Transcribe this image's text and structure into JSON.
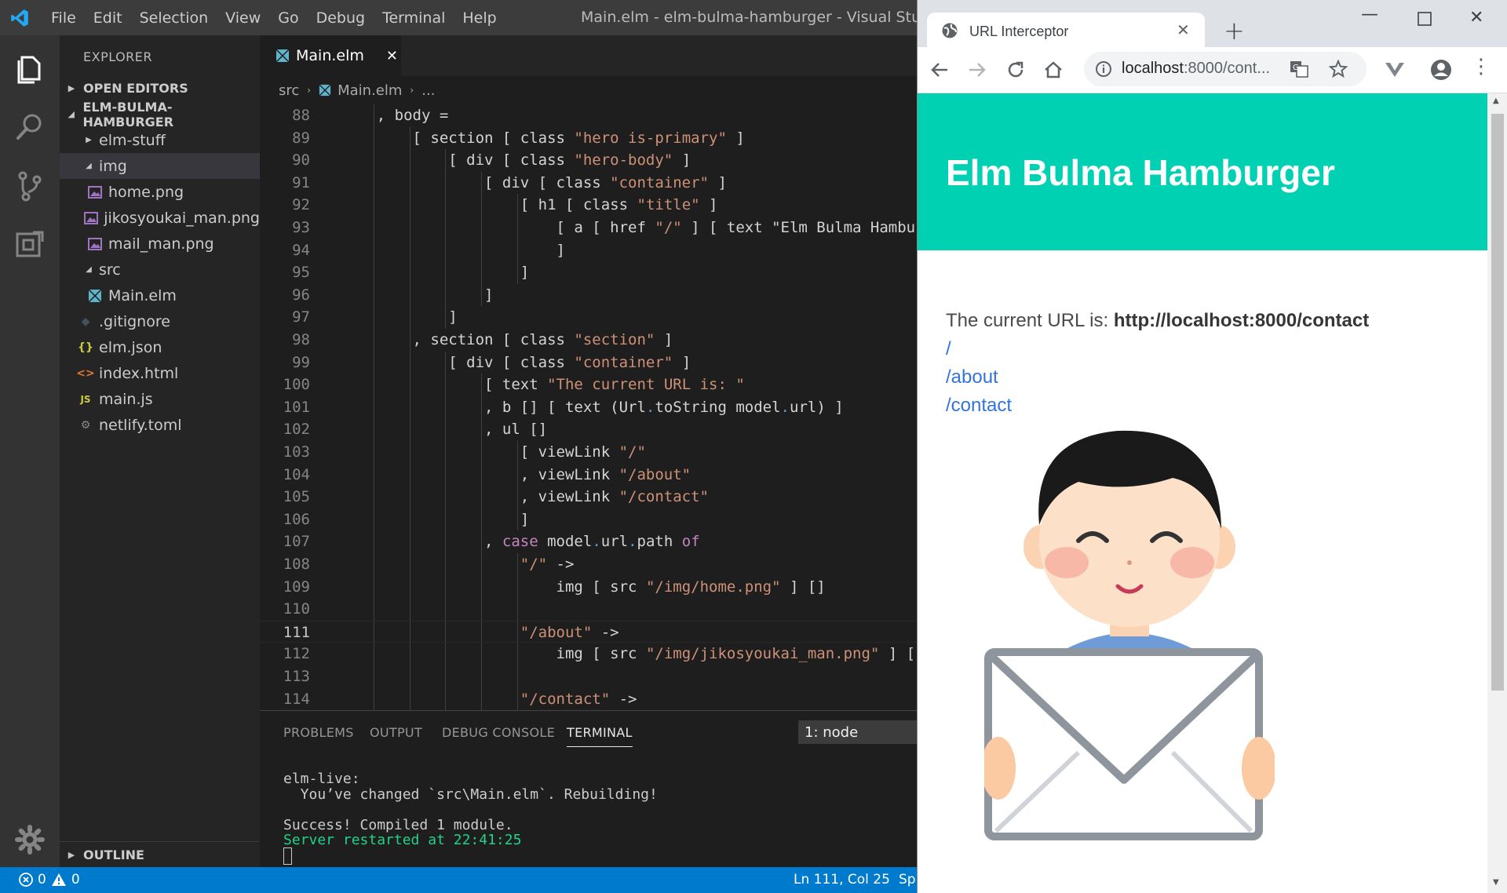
{
  "vscode": {
    "menu": [
      "File",
      "Edit",
      "Selection",
      "View",
      "Go",
      "Debug",
      "Terminal",
      "Help"
    ],
    "window_title": "Main.elm - elm-bulma-hamburger - Visual Studio Code",
    "explorer_title": "EXPLORER",
    "sections": {
      "open_editors": "OPEN EDITORS",
      "project": "ELM-BULMA-HAMBURGER",
      "outline": "OUTLINE"
    },
    "tree": [
      {
        "label": "elm-stuff",
        "type": "folder",
        "expanded": false,
        "depth": 1
      },
      {
        "label": "img",
        "type": "folder",
        "expanded": true,
        "depth": 1
      },
      {
        "label": "home.png",
        "type": "image",
        "depth": 2
      },
      {
        "label": "jikosyoukai_man.png",
        "type": "image",
        "depth": 2
      },
      {
        "label": "mail_man.png",
        "type": "image",
        "depth": 2
      },
      {
        "label": "src",
        "type": "folder",
        "expanded": true,
        "depth": 1
      },
      {
        "label": "Main.elm",
        "type": "elm",
        "depth": 2
      },
      {
        "label": ".gitignore",
        "type": "git",
        "depth": 1
      },
      {
        "label": "elm.json",
        "type": "json",
        "depth": 1
      },
      {
        "label": "index.html",
        "type": "html",
        "depth": 1
      },
      {
        "label": "main.js",
        "type": "js",
        "depth": 1
      },
      {
        "label": "netlify.toml",
        "type": "gear",
        "depth": 1
      }
    ],
    "active_tab": "Main.elm",
    "breadcrumb": [
      "src",
      "Main.elm",
      "..."
    ],
    "code": [
      {
        "n": "88",
        "text": "    , body ="
      },
      {
        "n": "89",
        "text": "        [ section [ class \"hero is-primary\" ]"
      },
      {
        "n": "90",
        "text": "            [ div [ class \"hero-body\" ]"
      },
      {
        "n": "91",
        "text": "                [ div [ class \"container\" ]"
      },
      {
        "n": "92",
        "text": "                    [ h1 [ class \"title\" ]"
      },
      {
        "n": "93",
        "text": "                        [ a [ href \"/\" ] [ text \"Elm Bulma Hambu"
      },
      {
        "n": "94",
        "text": "                        ]"
      },
      {
        "n": "95",
        "text": "                    ]"
      },
      {
        "n": "96",
        "text": "                ]"
      },
      {
        "n": "97",
        "text": "            ]"
      },
      {
        "n": "98",
        "text": "        , section [ class \"section\" ]"
      },
      {
        "n": "99",
        "text": "            [ div [ class \"container\" ]"
      },
      {
        "n": "100",
        "text": "                [ text \"The current URL is: \""
      },
      {
        "n": "101",
        "text": "                , b [] [ text (Url.toString model.url) ]"
      },
      {
        "n": "102",
        "text": "                , ul []"
      },
      {
        "n": "103",
        "text": "                    [ viewLink \"/\""
      },
      {
        "n": "104",
        "text": "                    , viewLink \"/about\""
      },
      {
        "n": "105",
        "text": "                    , viewLink \"/contact\""
      },
      {
        "n": "106",
        "text": "                    ]"
      },
      {
        "n": "107",
        "text": "                , case model.url.path of"
      },
      {
        "n": "108",
        "text": "                    \"/\" ->"
      },
      {
        "n": "109",
        "text": "                        img [ src \"/img/home.png\" ] []"
      },
      {
        "n": "110",
        "text": ""
      },
      {
        "n": "111",
        "text": "                    \"/about\" ->"
      },
      {
        "n": "112",
        "text": "                        img [ src \"/img/jikosyoukai_man.png\" ] ["
      },
      {
        "n": "113",
        "text": ""
      },
      {
        "n": "114",
        "text": "                    \"/contact\" ->"
      }
    ],
    "current_line": "111",
    "panel_tabs": [
      "PROBLEMS",
      "OUTPUT",
      "DEBUG CONSOLE",
      "TERMINAL"
    ],
    "active_panel_tab": "TERMINAL",
    "terminal_select": "1: node",
    "terminal_lines": [
      {
        "text": "elm-live:",
        "style": "normal"
      },
      {
        "text": "  You’ve changed `src\\Main.elm`. Rebuilding!",
        "style": "normal"
      },
      {
        "text": "",
        "style": "normal"
      },
      {
        "text": "Success! Compiled 1 module.",
        "style": "normal"
      },
      {
        "text": "Server restarted at 22:41:25",
        "style": "green"
      }
    ],
    "status": {
      "errors": "0",
      "warnings": "0",
      "position": "Ln 111, Col 25",
      "spaces": "Sp"
    }
  },
  "browser": {
    "tab_title": "URL Interceptor",
    "url_host": "localhost",
    "url_rest": ":8000/cont...",
    "hero_title": "Elm Bulma Hamburger",
    "current_url_label": "The current URL is: ",
    "current_url": "http://localhost:8000/contact",
    "links": [
      "/",
      "/about",
      "/contact"
    ]
  },
  "colors": {
    "vscode_blue": "#007acc",
    "bulma_primary": "#00d1b2",
    "link": "#3273dc",
    "string": "#ce9178",
    "keyword": "#c586c0"
  }
}
